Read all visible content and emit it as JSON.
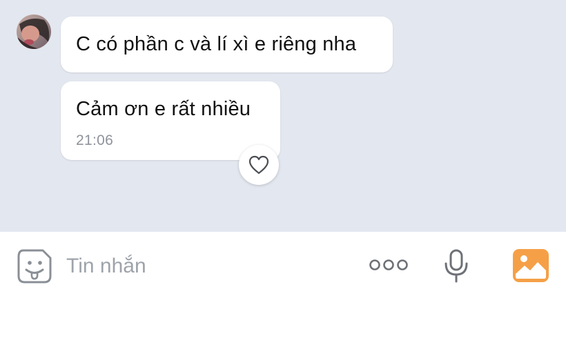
{
  "conversation": {
    "messages": [
      {
        "text": "C có phần c và lí xì e riêng nha"
      },
      {
        "text": "Cảm ơn e rất nhiều",
        "time": "21:06"
      }
    ]
  },
  "composer": {
    "placeholder": "Tin nhắn"
  },
  "icons": {
    "avatar": "contact-avatar",
    "reaction": "heart-icon",
    "sticker": "sticker-face-icon",
    "more": "more-dots-icon",
    "voice": "microphone-icon",
    "gallery": "photo-gallery-icon"
  },
  "colors": {
    "chat_background": "#e3e7ef",
    "bubble": "#ffffff",
    "timestamp": "#8e939b",
    "icon_gray": "#8a8f96",
    "gallery_orange": "#f5a047"
  }
}
